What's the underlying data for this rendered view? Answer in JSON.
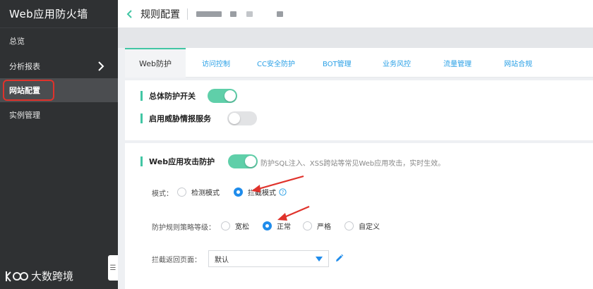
{
  "sidebar": {
    "title": "Web应用防火墙",
    "items": [
      {
        "label": "总览"
      },
      {
        "label": "分析报表"
      },
      {
        "label": "网站配置"
      },
      {
        "label": "实例管理"
      }
    ],
    "collapse_glyph": "☰",
    "watermark": "大数跨境"
  },
  "header": {
    "title": "规则配置"
  },
  "tabs": [
    {
      "label": "Web防护"
    },
    {
      "label": "访问控制"
    },
    {
      "label": "CC安全防护"
    },
    {
      "label": "BOT管理"
    },
    {
      "label": "业务风控"
    },
    {
      "label": "流量管理"
    },
    {
      "label": "网站合规"
    }
  ],
  "general": {
    "master_switch_label": "总体防护开关",
    "master_switch_on": true,
    "threat_intel_label": "启用威胁情报服务",
    "threat_intel_on": false
  },
  "waf": {
    "title": "Web应用攻击防护",
    "enabled": true,
    "description": "防护SQL注入、XSS跨站等常见Web应用攻击，实时生效。",
    "mode_label": "模式：",
    "mode_options": [
      "检测模式",
      "拦截模式"
    ],
    "mode_selected": "拦截模式",
    "level_label": "防护规则策略等级：",
    "level_options": [
      "宽松",
      "正常",
      "严格",
      "自定义"
    ],
    "level_selected": "正常",
    "block_page_label": "拦截返回页面：",
    "block_page_value": "默认"
  },
  "colors": {
    "accent": "#42c6a4",
    "toggle_on": "#5fcfa9",
    "radio_selected": "#1f8ceb",
    "link": "#2aa0e6",
    "annotation_arrow": "#e0322b"
  }
}
